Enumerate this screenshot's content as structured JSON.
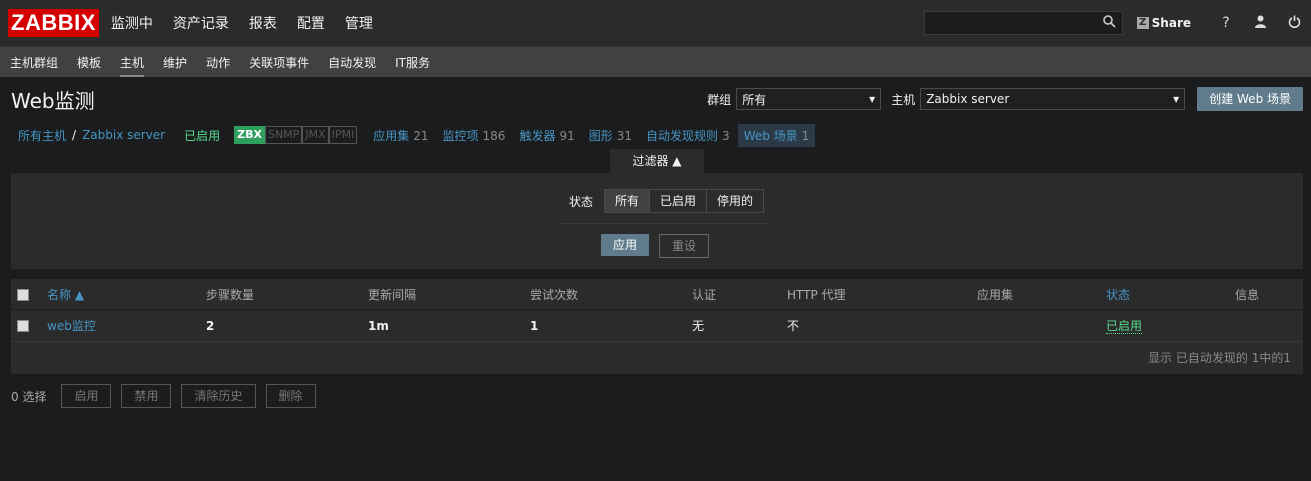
{
  "app": {
    "logo": "ZABBIX",
    "main_menu": [
      "监测中",
      "资产记录",
      "报表",
      "配置",
      "管理"
    ],
    "search": {
      "value": "",
      "placeholder": ""
    },
    "share_label": "Share",
    "help_icon": "?",
    "sub_menu": [
      "主机群组",
      "模板",
      "主机",
      "维护",
      "动作",
      "关联项事件",
      "自动发现",
      "IT服务"
    ],
    "sub_menu_selected": "主机"
  },
  "header": {
    "title": "Web监测",
    "group_label": "群组",
    "group_value": "所有",
    "host_label": "主机",
    "host_value": "Zabbix server",
    "create_button": "创建 Web 场景"
  },
  "nav": {
    "all_hosts": "所有主机",
    "separator": "/",
    "host": "Zabbix server",
    "status": "已启用",
    "tags": [
      "ZBX",
      "SNMP",
      "JMX",
      "IPMI"
    ],
    "links": [
      {
        "label": "应用集",
        "count": "21"
      },
      {
        "label": "监控项",
        "count": "186"
      },
      {
        "label": "触发器",
        "count": "91"
      },
      {
        "label": "图形",
        "count": "31"
      },
      {
        "label": "自动发现规则",
        "count": "3"
      },
      {
        "label": "Web 场景",
        "count": "1"
      }
    ]
  },
  "filter": {
    "tab_label": "过滤器 ▲",
    "status_label": "状态",
    "status_options": [
      "所有",
      "已启用",
      "停用的"
    ],
    "apply": "应用",
    "reset": "重设"
  },
  "table": {
    "headers": [
      "名称 ▲",
      "步骤数量",
      "更新间隔",
      "尝试次数",
      "认证",
      "HTTP 代理",
      "应用集",
      "状态",
      "信息"
    ],
    "rows": [
      {
        "name": "web监控",
        "steps": "2",
        "interval": "1m",
        "attempts": "1",
        "auth": "无",
        "proxy": "不",
        "apps": "",
        "status": "已启用",
        "info": ""
      }
    ],
    "footer": "显示 已自动发现的 1中的1"
  },
  "actions": {
    "selected": "0 选择",
    "buttons": [
      "启用",
      "禁用",
      "清除历史",
      "删除"
    ]
  },
  "colors": {
    "accent": "#d40000",
    "link": "#4796c4",
    "enabled": "#59db8f",
    "button": "#5f7b8c"
  }
}
